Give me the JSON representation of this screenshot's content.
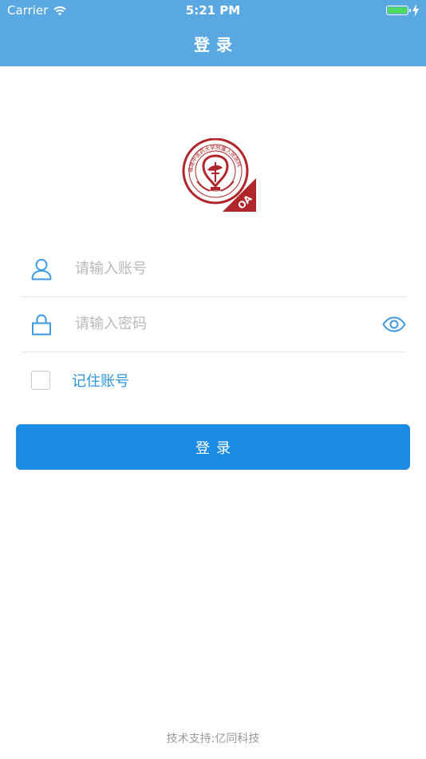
{
  "status_bar": {
    "carrier": "Carrier",
    "time": "5:21 PM"
  },
  "nav": {
    "title": "登录"
  },
  "logo": {
    "seal_text": "福建中医药大学附属人民医院",
    "badge_text": "OA",
    "brand_color": "#b0262b"
  },
  "form": {
    "account_placeholder": "请输入账号",
    "password_placeholder": "请输入密码",
    "remember_label": "记住账号",
    "remember_checked": false,
    "icons": {
      "account": "user-icon",
      "password": "lock-icon",
      "visibility": "eye-icon"
    }
  },
  "login_button": {
    "label": "登录"
  },
  "footer": {
    "text": "技术支持:亿同科技"
  },
  "colors": {
    "nav_bg": "#5aa8e2",
    "primary": "#1b8ce3",
    "icon": "#3d9ae0",
    "battery": "#4cd964"
  }
}
